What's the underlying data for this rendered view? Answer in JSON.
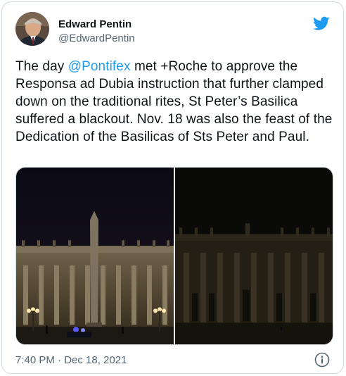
{
  "author": {
    "name": "Edward Pentin",
    "handle": "@EdwardPentin"
  },
  "tweet": {
    "pre": "The day ",
    "mention": "@Pontifex",
    "post": " met +Roche to approve the Responsa ad Dubia instruction that further clamped down on the traditional rites, St Peter’s Basilica suffered a blackout. Nov. 18 was also the feast of the Dedication of the Basilicas of Sts Peter and Paul."
  },
  "timestamp": "7:40 PM · Dec 18, 2021",
  "icons": {
    "brand": "twitter-bird-icon",
    "info": "info-icon"
  },
  "colors": {
    "accent": "#1d9bf0",
    "text": "#0f1419",
    "muted": "#536471",
    "border": "#cfd9de"
  }
}
